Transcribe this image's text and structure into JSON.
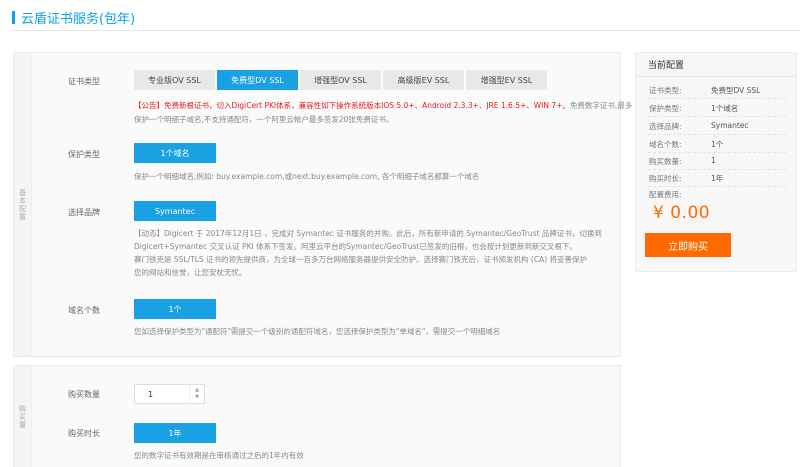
{
  "page": {
    "title": "云盾证书服务(包年)"
  },
  "section1": {
    "side_label": "基本配置",
    "cert_type": {
      "label": "证书类型",
      "options": [
        "专业版OV SSL",
        "免费型DV SSL",
        "增强型OV SSL",
        "高级版EV SSL",
        "增强型EV SSL"
      ],
      "selected": "免费型DV SSL",
      "notice_red": "【公告】免费新根证书，切入DigiCert PKI体系，兼容性如下操作系统版本IOS 5.0+、Android 2.3.3+、JRE 1.6.5+、WIN 7+。",
      "notice_gray": "免费数字证书,最多保护一个明细子域名,不支持通配符，一个阿里云帐户最多签发20张免费证书。"
    },
    "protect_type": {
      "label": "保护类型",
      "value": "1个域名",
      "desc": "保护一个明细域名,例如: buy.example.com,或next.buy.example.com, 各个明细子域名都算一个域名"
    },
    "brand": {
      "label": "选择品牌",
      "value": "Symantec",
      "desc_lines": [
        "【动态】Digicert 于 2017年12月1日 ，完成对 Symantec 证书服务的并购。此后，所有新申请的 Symantec/GeoTrust 品牌证书，切换到",
        "Digicert+Symantec 交叉认证 PKI 体系下签发。阿里云平台的Symantec/GeoTrust已签发的旧根，也会按计划更新到新交叉根下。",
        "赛门铁克是 SSL/TLS 证书的领先提供商，为全球一百多万台网络服务器提供安全防护。选择赛门铁克后，证书颁发机构 (CA) 将妥善保护",
        "您的网站和信誉，让您安枕无忧。"
      ]
    },
    "domain_count": {
      "label": "域名个数",
      "value": "1个",
      "desc": "您如选择保护类型为\"通配符\"需提交一个级别的通配符域名，您选择保护类型为\"单域名\"，需提交一个明细域名"
    }
  },
  "section2": {
    "side_label": "购买量",
    "quantity": {
      "label": "购买数量",
      "value": "1",
      "up": "▲",
      "down": "▼"
    },
    "duration": {
      "label": "购买时长",
      "value": "1年",
      "desc": "您的数字证书有效期是在审核通过之后的1年内有效"
    }
  },
  "config_panel": {
    "title": "当前配置",
    "rows": [
      {
        "k": "证书类型:",
        "v": "免费型DV SSL"
      },
      {
        "k": "保护类型:",
        "v": "1个域名"
      },
      {
        "k": "选择品牌:",
        "v": "Symantec"
      },
      {
        "k": "域名个数:",
        "v": "1个"
      },
      {
        "k": "购买数量:",
        "v": "1"
      },
      {
        "k": "购买时长:",
        "v": "1年"
      }
    ],
    "fee_label": "配置费用:",
    "price": "¥ 0.00",
    "buy_label": "立即购买"
  },
  "colors": {
    "accent": "#1aa1e4",
    "title": "#0aa1ed",
    "notice_red": "#e02020",
    "price": "#ff6a00",
    "buy_button": "#ff6a00"
  }
}
